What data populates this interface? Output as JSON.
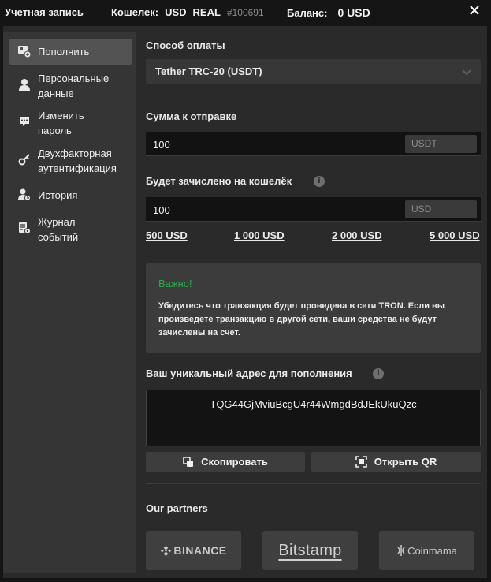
{
  "topbar": {
    "title": "Учетная запись",
    "wallet_label": "Кошелек:",
    "currency": "USD",
    "mode": "REAL",
    "account_id": "#100691",
    "balance_label": "Баланс:",
    "balance_value": "0 USD",
    "close_icon": "close-icon"
  },
  "sidebar": {
    "items": [
      {
        "label": "Пополнить",
        "icon": "deposit-icon",
        "active": true
      },
      {
        "label": "Персональные данные",
        "icon": "user-icon",
        "active": false
      },
      {
        "label": "Изменить пароль",
        "icon": "password-icon",
        "active": false
      },
      {
        "label": "Двухфакторная аутентификация",
        "icon": "key-icon",
        "active": false
      },
      {
        "label": "История",
        "icon": "history-icon",
        "active": false
      },
      {
        "label": "Журнал событий",
        "icon": "journal-icon",
        "active": false
      }
    ]
  },
  "deposit": {
    "method_label": "Способ оплаты",
    "method_value": "Tether TRC-20 (USDT)",
    "send_label": "Сумма к отправке",
    "send_value": "100",
    "send_unit": "USDT",
    "credit_label": "Будет зачислено на кошелёк",
    "credit_value": "100",
    "credit_unit": "USD",
    "quick_amounts": [
      "500 USD",
      "1 000 USD",
      "2 000 USD",
      "5 000 USD"
    ],
    "notice_title": "Важно!",
    "notice_text": "Убедитесь что транзакция будет проведена в сети TRON. Если вы произведете транзакцию в другой сети, ваши средства не будут зачислены на счет.",
    "address_label": "Ваш уникальный адрес для пополнения",
    "address_value": "TQG44GjMviuBcgU4r44WmgdBdJEkUkuQzc",
    "copy_button": "Скопировать",
    "qr_button": "Открыть QR",
    "partners_label": "Our partners",
    "partners": [
      "BINANCE",
      "Bitstamp",
      "Coinmama"
    ]
  },
  "colors": {
    "background": "#151515",
    "panel": "#2a2a2a",
    "sidebar": "#353535",
    "active_item": "#535353",
    "input": "#121212",
    "notice_title": "#2fa84f"
  }
}
